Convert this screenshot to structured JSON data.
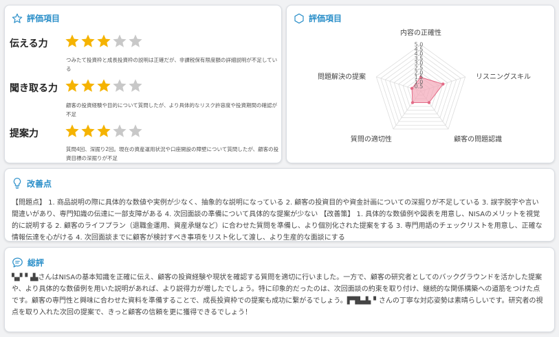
{
  "colors": {
    "accent": "#2b8fc9",
    "star_filled": "#f5b301",
    "star_empty": "#c8c8c8",
    "radar_fill": "#f4a6b8",
    "radar_stroke": "#e36a86"
  },
  "rating_card": {
    "title": "評価項目",
    "icon": "star-outline-icon",
    "items": [
      {
        "label": "伝える力",
        "stars_filled": 3,
        "stars_total": 5,
        "comment": "つみたて投資枠と成長投資枠の説明は正確だが、非課税保有限度額の詳細説明が不足している"
      },
      {
        "label": "聞き取る力",
        "stars_filled": 3,
        "stars_total": 5,
        "comment": "顧客の投資経験や目的について質問したが、より具体的なリスク許容度や投資期間の確認が不足"
      },
      {
        "label": "提案力",
        "stars_filled": 3,
        "stars_total": 5,
        "comment": "質問4回、深掘り2回。現在の資産運用状況や口座開設の障壁について質問したが、顧客の投資目標の深掘りが不足"
      }
    ]
  },
  "radar_card": {
    "title": "評価項目",
    "icon": "hexagon-outline-icon"
  },
  "chart_data": {
    "type": "radar",
    "axes": [
      "内容の正確性",
      "リスニングスキル",
      "顧客の問題認識",
      "質問の適切性",
      "問題解決の提案"
    ],
    "scale_max": 5.0,
    "scale_ticks": [
      "0.5",
      "1.0",
      "1.5",
      "2.0",
      "2.5",
      "3.0",
      "3.5",
      "4.0",
      "4.5",
      "5.0"
    ],
    "values": [
      1.5,
      2.5,
      1.5,
      1.5,
      1.0
    ],
    "grid": true
  },
  "improvement": {
    "title": "改善点",
    "icon": "lightbulb-icon",
    "text": "【問題点】 1. 商品説明の際に具体的な数値や実例が少なく、抽象的な説明になっている 2. 顧客の投資目的や資金計画についての深掘りが不足している 3. 誤字脱字や言い間違いがあり、専門知識の伝達に一部支障がある 4. 次回面談の準備について具体的な提案が少ない 【改善策】 1. 具体的な数値例や図表を用意し、NISAのメリットを視覚的に説明する 2. 顧客のライフプラン（退職金運用、資産承継など）に合わせた質問を準備し、より個別化された提案をする 3. 専門用語のチェックリストを用意し、正確な情報伝達を心がける 4. 次回面談までに顧客が検討すべき事項をリスト化して渡し、より生産的な面談にする"
  },
  "summary": {
    "title": "総評",
    "icon": "chat-bubble-icon",
    "text": "▚▞▝▗▙さんはNISAの基本知識を正確に伝え、顧客の投資経験や現状を確認する質問を適切に行いました。一方で、顧客の研究者としてのバックグラウンドを活かした提案や、より具体的な数値例を用いた説明があれば、より説得力が増したでしょう。特に印象的だったのは、次回面談の約束を取り付け、継続的な関係構築への道筋をつけた点です。顧客の専門性と興味に合わせた資料を準備することで、成長投資枠での提案も成功に繋がるでしょう。▛▜▙▟▖▘さんの丁寧な対応姿勢は素晴らしいです。研究者の視点を取り入れた次回の提案で、きっと顧客の信頼を更に獲得できるでしょう！"
  }
}
